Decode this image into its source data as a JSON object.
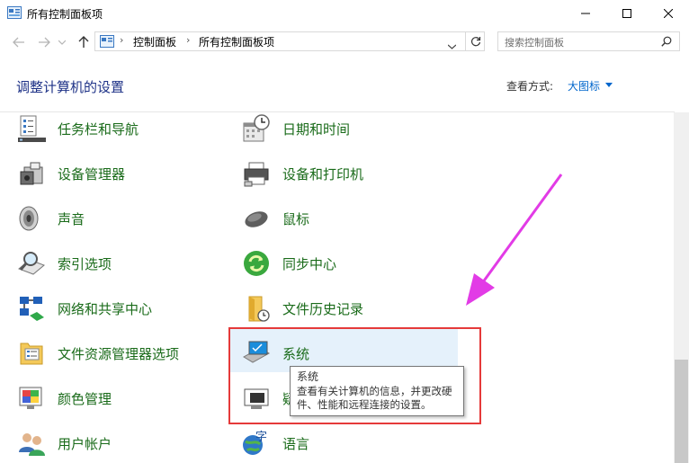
{
  "window": {
    "title": "所有控制面板项"
  },
  "address": {
    "crumbs": [
      "控制面板",
      "所有控制面板项"
    ]
  },
  "search": {
    "placeholder": "搜索控制面板"
  },
  "header": {
    "title": "调整计算机的设置",
    "view_by_label": "查看方式:",
    "view_by_value": "大图标"
  },
  "items_left": [
    {
      "label": "任务栏和导航",
      "icon": "taskbar-icon"
    },
    {
      "label": "设备管理器",
      "icon": "device-manager-icon"
    },
    {
      "label": "声音",
      "icon": "speaker-icon"
    },
    {
      "label": "索引选项",
      "icon": "indexing-icon"
    },
    {
      "label": "网络和共享中心",
      "icon": "network-icon"
    },
    {
      "label": "文件资源管理器选项",
      "icon": "folder-options-icon"
    },
    {
      "label": "颜色管理",
      "icon": "color-management-icon"
    },
    {
      "label": "用户帐户",
      "icon": "user-accounts-icon"
    }
  ],
  "items_right": [
    {
      "label": "日期和时间",
      "icon": "date-time-icon"
    },
    {
      "label": "设备和打印机",
      "icon": "printer-icon"
    },
    {
      "label": "鼠标",
      "icon": "mouse-icon"
    },
    {
      "label": "同步中心",
      "icon": "sync-icon"
    },
    {
      "label": "文件历史记录",
      "icon": "file-history-icon"
    },
    {
      "label": "系统",
      "icon": "system-icon"
    },
    {
      "label": "疑",
      "icon": "troubleshoot-icon"
    },
    {
      "label": "语言",
      "icon": "language-icon"
    }
  ],
  "tooltip": {
    "title": "系统",
    "body": "查看有关计算机的信息，并更改硬件、性能和远程连接的设置。"
  },
  "colors": {
    "accent_link": "#0066cc",
    "item_text": "#1a6b1a",
    "title_blue": "#1e3287",
    "highlight_red": "#e53a3a",
    "arrow_magenta": "#e23be6",
    "hover_bg": "#e5f1fb"
  }
}
